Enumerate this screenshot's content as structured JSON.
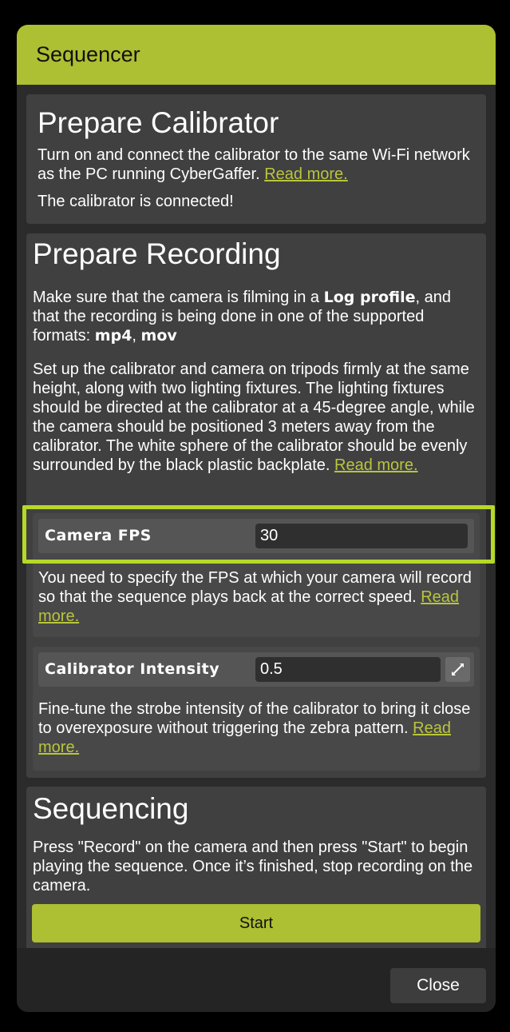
{
  "window": {
    "title": "Sequencer"
  },
  "prepare_calibrator": {
    "heading": "Prepare Calibrator",
    "body": "Turn on and connect the calibrator to the same Wi-Fi network as the PC running CyberGaffer.",
    "link": "Read more.",
    "status": "The calibrator is connected!"
  },
  "prepare_recording": {
    "heading": "Prepare Recording",
    "p1_a": "Make sure that the camera is filming in a ",
    "p1_bold1": "Log profile",
    "p1_b": ", and that the recording is being done in one of the supported formats: ",
    "p1_bold2": "mp4",
    "p1_c": ", ",
    "p1_bold3": "mov",
    "p2": "Set up the calibrator and camera on tripods firmly at the same height, along with two lighting fixtures. The lighting fixtures should be directed at the calibrator at a 45-degree angle, while the camera should be positioned 3 meters away from the calibrator. The white sphere of the calibrator should be evenly surrounded by the black plastic backplate.",
    "link": "Read more."
  },
  "camera_fps": {
    "label": "Camera FPS",
    "value": "30",
    "help": "You need to specify the FPS at which your camera will record so that the sequence plays back at the correct speed.",
    "link": "Read more."
  },
  "calibrator_intensity": {
    "label": "Calibrator Intensity",
    "value": "0.5",
    "help": "Fine-tune the strobe intensity of the calibrator to bring it close to overexposure without triggering the zebra pattern.",
    "link": "Read more."
  },
  "sequencing": {
    "heading": "Sequencing",
    "body": "Press \"Record\" on the camera and then press \"Start\" to begin playing the sequence. Once it’s finished, stop recording on the camera.",
    "start_label": "Start"
  },
  "footer": {
    "close_label": "Close"
  },
  "colors": {
    "accent": "#adbf32",
    "link": "#b9c53d",
    "success": "#2fd02f",
    "highlight": "#b6d827"
  }
}
